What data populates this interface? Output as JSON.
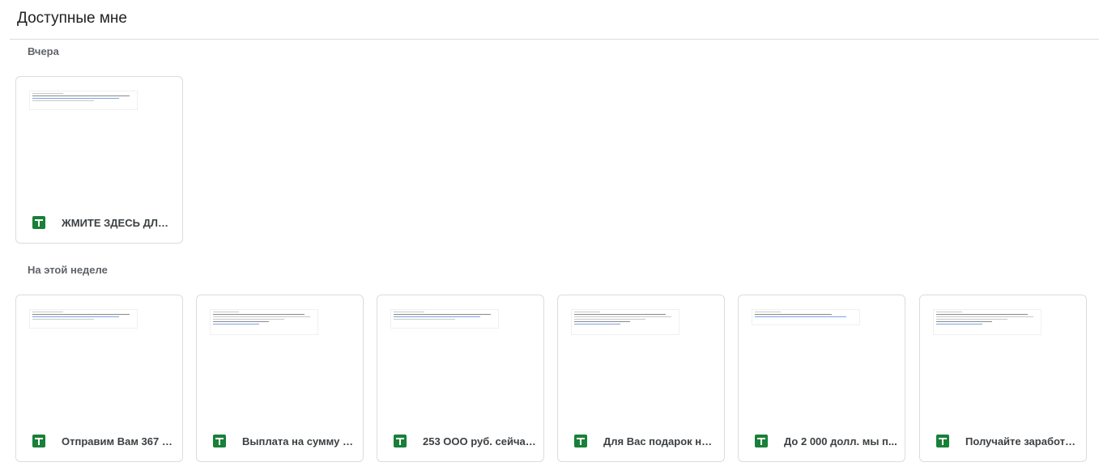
{
  "header": {
    "title": "Доступные мне"
  },
  "sections": [
    {
      "label": "Вчера",
      "files": [
        {
          "name": "ЖМИТЕ ЗДЕСЬ ДЛЯ ...",
          "icon": "sheets-icon"
        }
      ]
    },
    {
      "label": "На этой неделе",
      "files": [
        {
          "name": "Отправим Вам 367 д...",
          "icon": "sheets-icon"
        },
        {
          "name": "Выплата на сумму 3...",
          "icon": "sheets-icon"
        },
        {
          "name": "253 ООО руб. сейчас....",
          "icon": "sheets-icon"
        },
        {
          "name": "Для Вас подарок на ...",
          "icon": "sheets-icon"
        },
        {
          "name": "До 2 000 долл. мы п...",
          "icon": "sheets-icon"
        },
        {
          "name": "Получайте заработа...",
          "icon": "sheets-icon"
        }
      ]
    }
  ],
  "colors": {
    "sheets_green": "#188038",
    "border": "#dadce0",
    "text": "#3c4043"
  }
}
